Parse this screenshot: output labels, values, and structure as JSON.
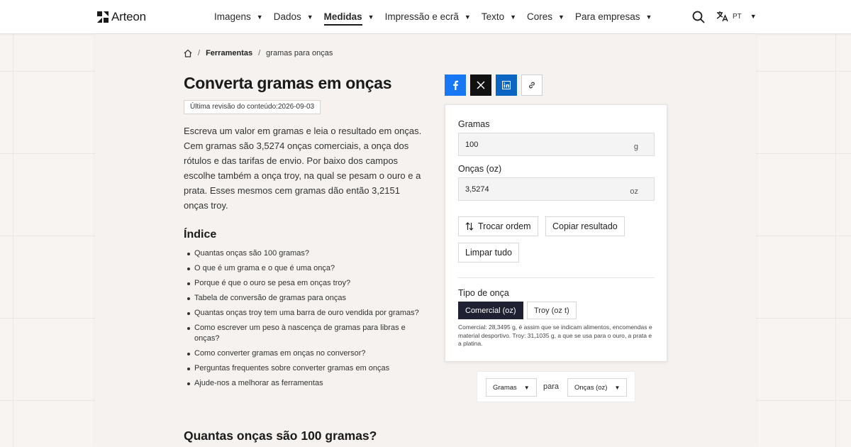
{
  "header": {
    "brand": "Arteon",
    "nav": [
      {
        "label": "Imagens",
        "active": false
      },
      {
        "label": "Dados",
        "active": false
      },
      {
        "label": "Medidas",
        "active": true
      },
      {
        "label": "Impressão e ecrã",
        "active": false
      },
      {
        "label": "Texto",
        "active": false
      },
      {
        "label": "Cores",
        "active": false
      },
      {
        "label": "Para empresas",
        "active": false
      }
    ],
    "language": "PT"
  },
  "breadcrumb": {
    "section": "Ferramentas",
    "current": "gramas para onças"
  },
  "page": {
    "title": "Converta gramas em onças",
    "revision": "Última revisão do conteúdo:2026-09-03",
    "intro": "Escreva um valor em gramas e leia o resultado em onças. Cem gramas são 3,5274 onças comerciais, a onça dos rótulos e das tarifas de envio. Por baixo dos campos escolhe também a onça troy, na qual se pesam o ouro e a prata. Esses mesmos cem gramas dão então 3,2151 onças troy.",
    "toc_title": "Índice",
    "toc": [
      "Quantas onças são 100 gramas?",
      "O que é um grama e o que é uma onça?",
      "Porque é que o ouro se pesa em onças troy?",
      "Tabela de conversão de gramas para onças",
      "Quantas onças troy tem uma barra de ouro vendida por gramas?",
      "Como escrever um peso à nascença de gramas para libras e onças?",
      "Como converter gramas em onças no conversor?",
      "Perguntas frequentes sobre converter gramas em onças",
      "Ajude-nos a melhorar as ferramentas"
    ],
    "section_title": "Quantas onças são 100 gramas?"
  },
  "converter": {
    "from_label": "Gramas",
    "from_value": "100",
    "from_unit": "g",
    "to_label": "Onças (oz)",
    "to_value": "3,5274",
    "to_unit": "oz",
    "swap_label": "Trocar ordem",
    "copy_label": "Copiar resultado",
    "clear_label": "Limpar tudo",
    "type_label": "Tipo de onça",
    "type_options": [
      "Comercial (oz)",
      "Troy (oz t)"
    ],
    "type_selected": "Comercial (oz)",
    "note": "Comercial: 28,3495 g, é assim que se indicam alimentos, encomendas e material desportivo. Troy: 31,1035 g, a que se usa para o ouro, a prata e a platina."
  },
  "unit_selector": {
    "from": "Gramas",
    "connector": "para",
    "to": "Onças (oz)"
  },
  "colors": {
    "facebook": "#1877f2",
    "x": "#111111",
    "linkedin": "#0a66c2",
    "selected_segment": "#1f2133"
  }
}
